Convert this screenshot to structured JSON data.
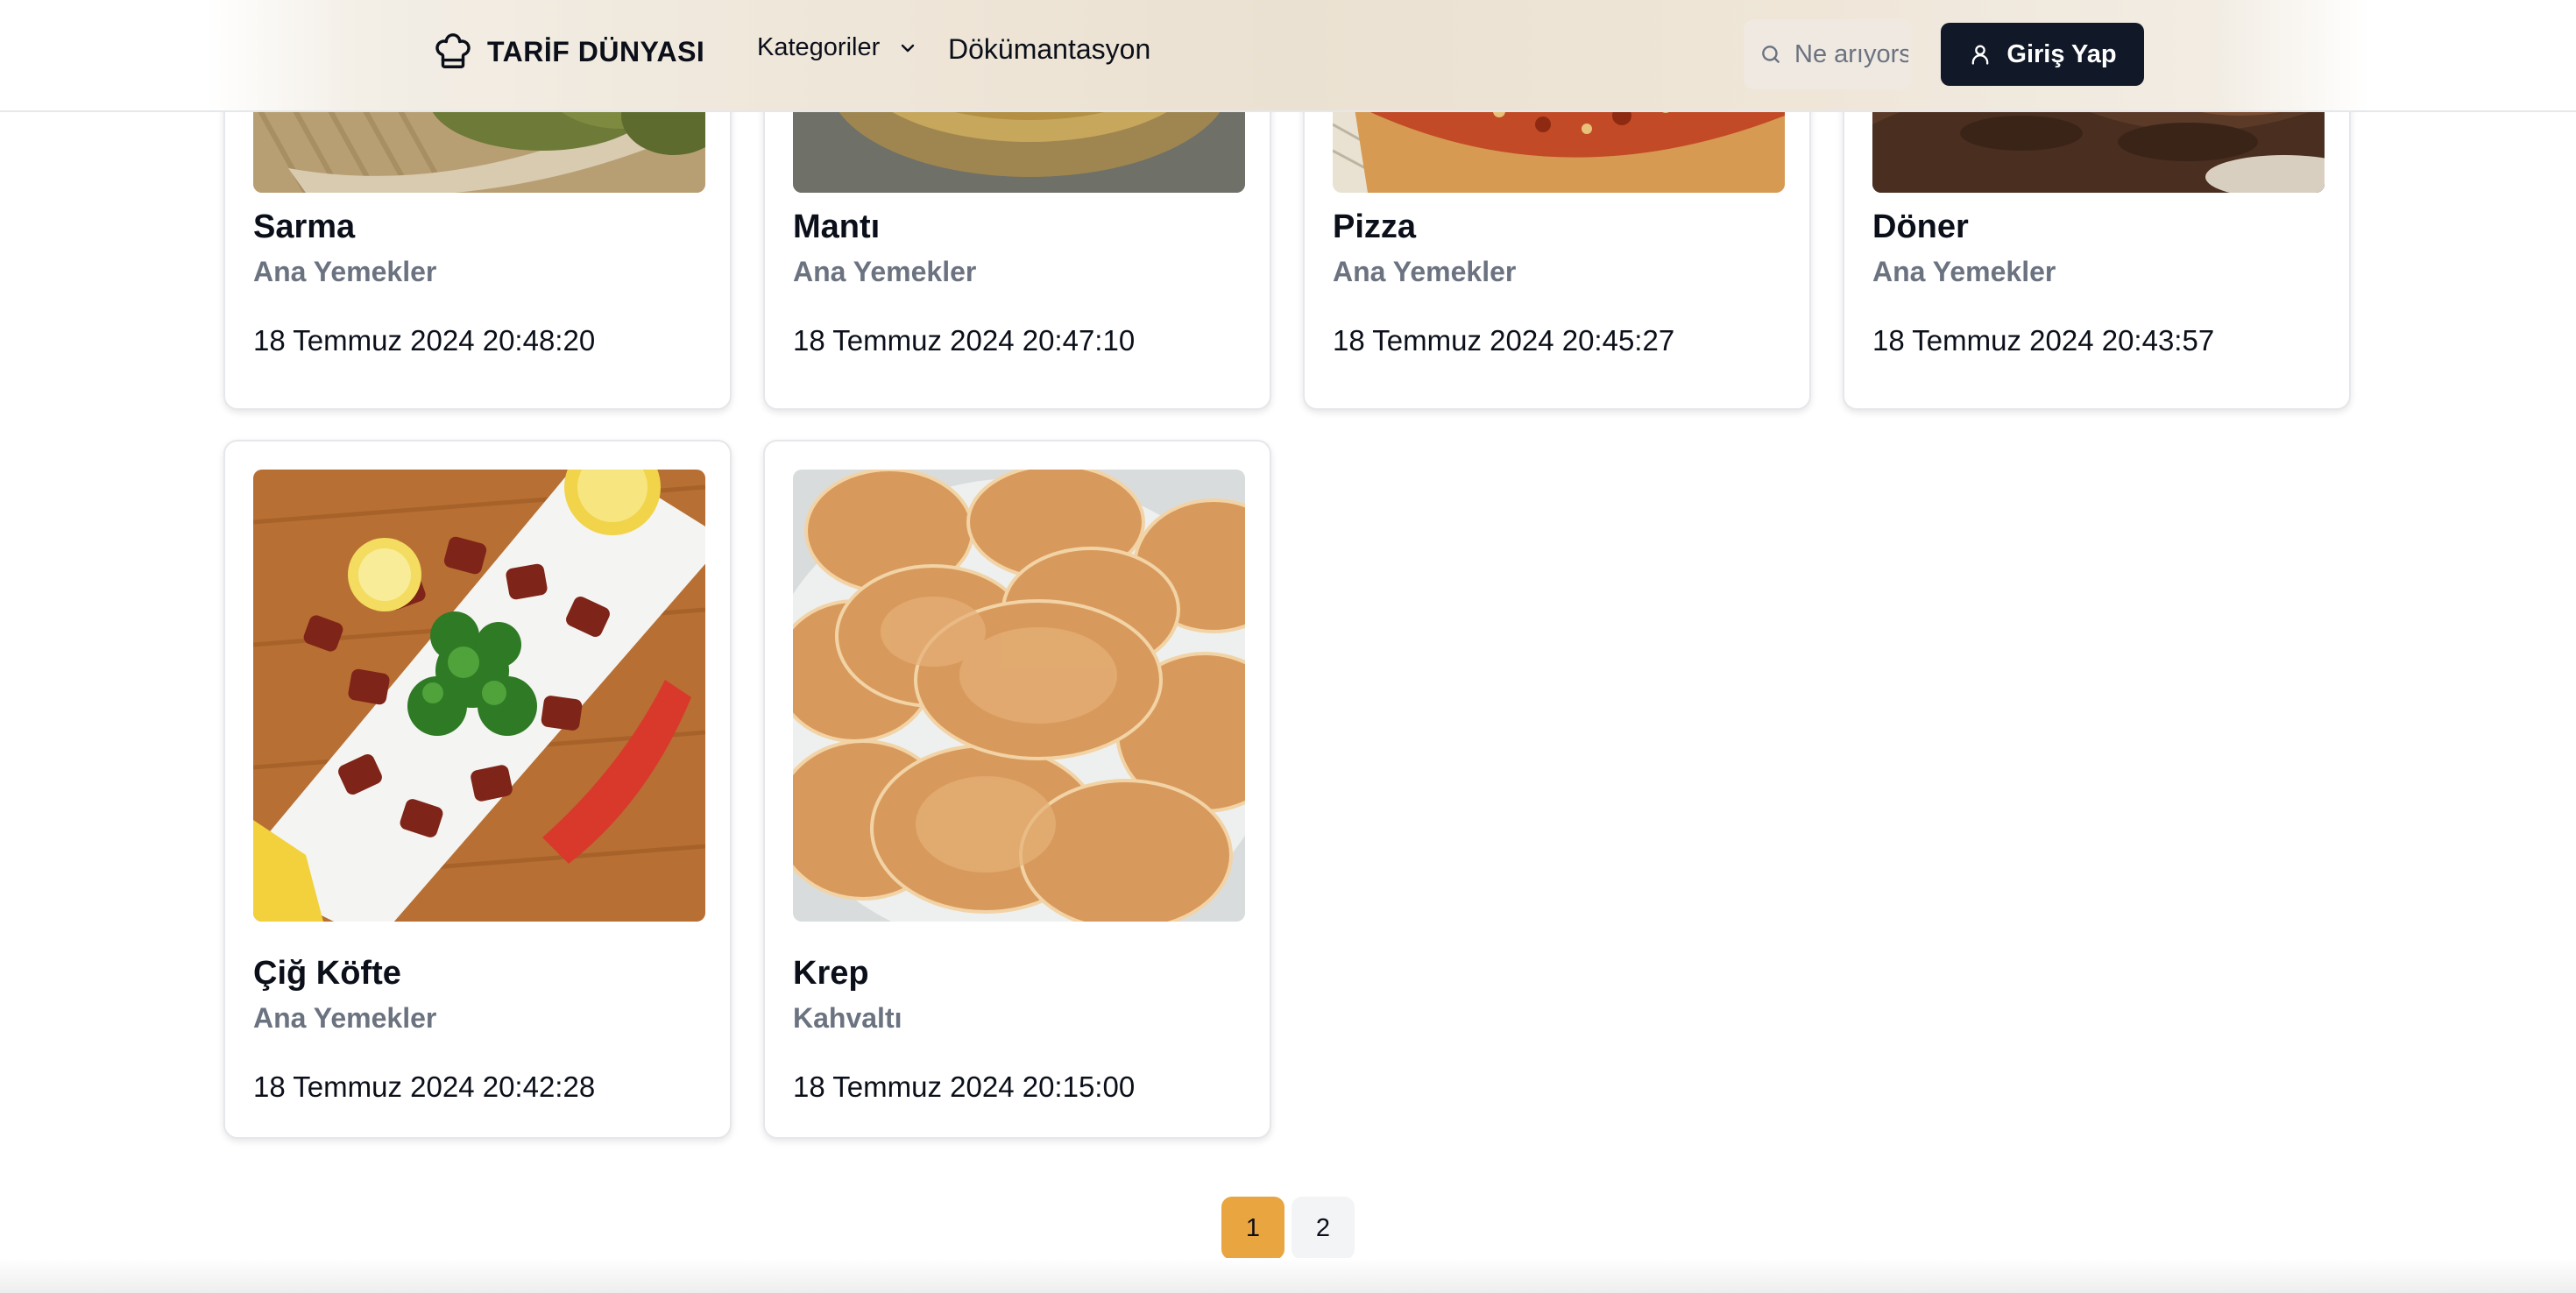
{
  "header": {
    "logo_text": "TARİF DÜNYASI",
    "nav_categories": "Kategoriler",
    "nav_docs": "Dökümantasyon",
    "search_placeholder": "Ne arıyorsun?",
    "login_label": "Giriş Yap"
  },
  "recipes": [
    {
      "title": "Sarma",
      "category": "Ana Yemekler",
      "date": "18 Temmuz 2024 20:48:20"
    },
    {
      "title": "Mantı",
      "category": "Ana Yemekler",
      "date": "18 Temmuz 2024 20:47:10"
    },
    {
      "title": "Pizza",
      "category": "Ana Yemekler",
      "date": "18 Temmuz 2024 20:45:27"
    },
    {
      "title": "Döner",
      "category": "Ana Yemekler",
      "date": "18 Temmuz 2024 20:43:57"
    },
    {
      "title": "Çiğ Köfte",
      "category": "Ana Yemekler",
      "date": "18 Temmuz 2024 20:42:28"
    },
    {
      "title": "Krep",
      "category": "Kahvaltı",
      "date": "18 Temmuz 2024 20:15:00"
    }
  ],
  "pagination": {
    "pages": [
      "1",
      "2"
    ],
    "current": "1"
  },
  "colors": {
    "accent": "#e9a540",
    "primary_button": "#111827",
    "muted_text": "#6b7280"
  }
}
